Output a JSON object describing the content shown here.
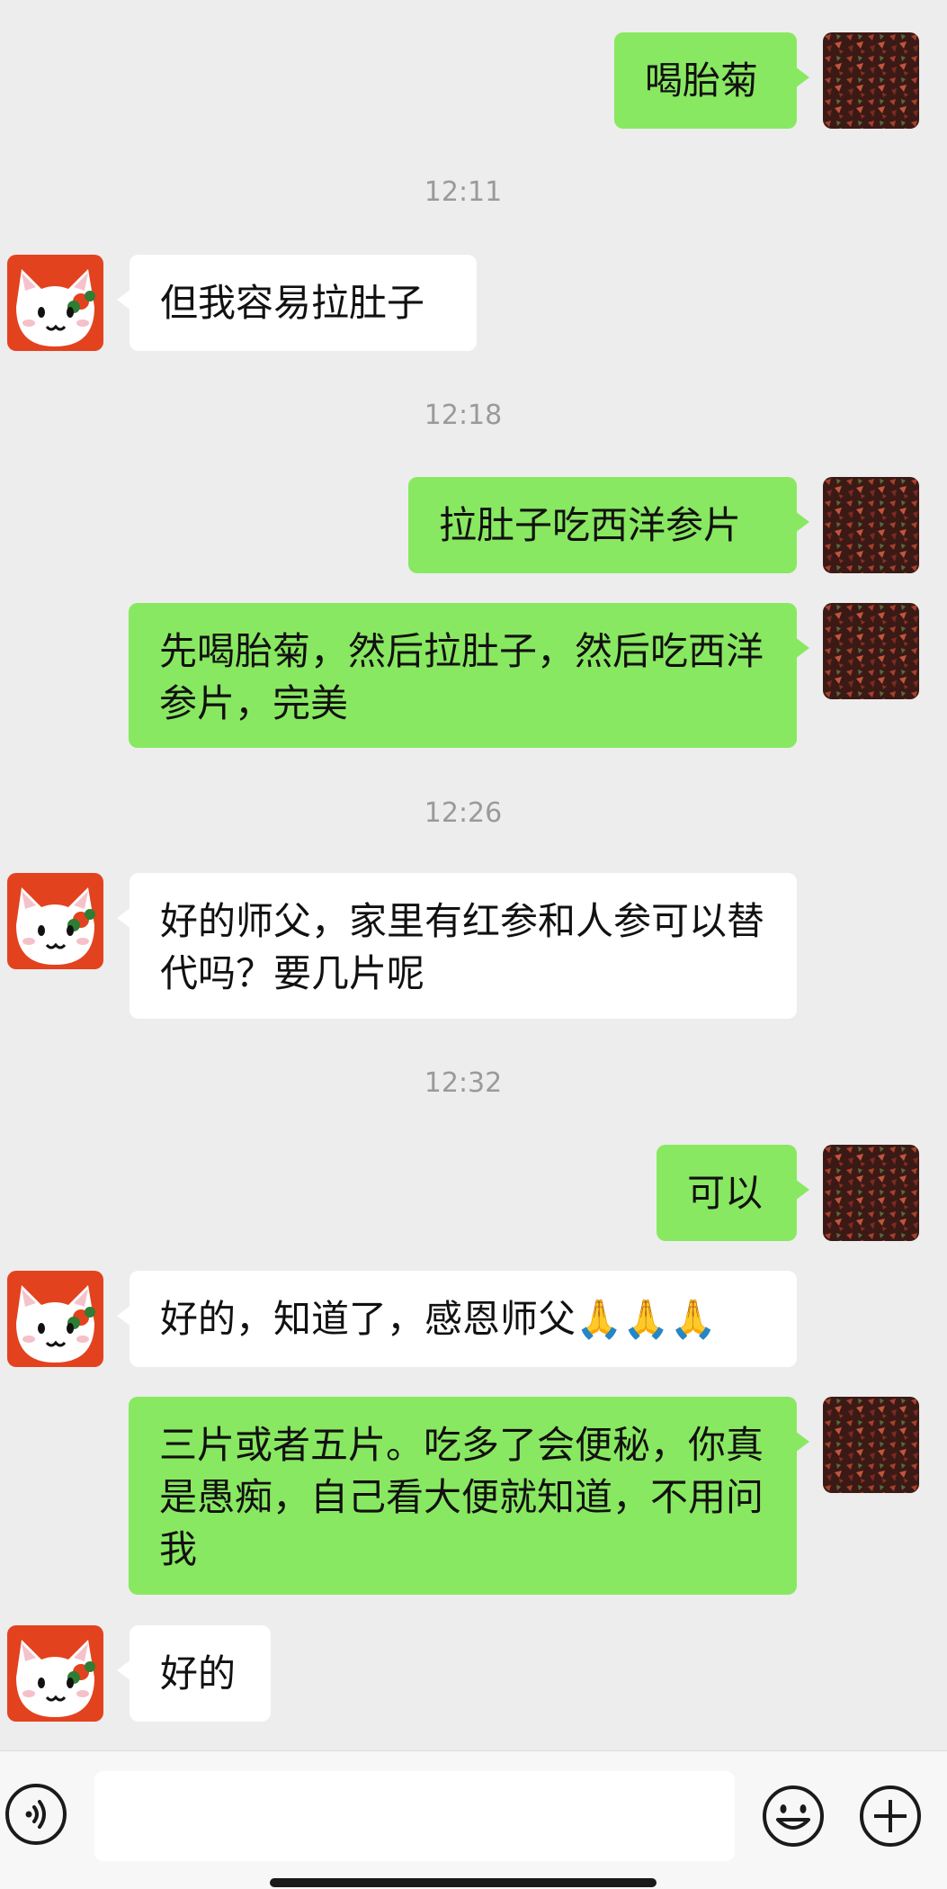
{
  "colors": {
    "background": "#ededed",
    "my_bubble": "#89e861",
    "their_bubble": "#ffffff",
    "timestamp": "#9a9a9a"
  },
  "messages": [
    {
      "side": "me",
      "text": "喝胎菊"
    },
    {
      "time": "12:11"
    },
    {
      "side": "them",
      "text": "但我容易拉肚子"
    },
    {
      "time": "12:18"
    },
    {
      "side": "me",
      "text": "拉肚子吃西洋参片"
    },
    {
      "side": "me",
      "text": "先喝胎菊，然后拉肚子，然后吃西洋参片，完美"
    },
    {
      "time": "12:26"
    },
    {
      "side": "them",
      "text": "好的师父，家里有红参和人参可以替代吗？要几片呢"
    },
    {
      "time": "12:32"
    },
    {
      "side": "me",
      "text": "可以"
    },
    {
      "side": "them",
      "text": "好的，知道了，感恩师父🙏🙏🙏"
    },
    {
      "side": "me",
      "text": "三片或者五片。吃多了会便秘，你真是愚痴，自己看大便就知道，不用问我"
    },
    {
      "side": "them",
      "text": "好的"
    }
  ],
  "input_bar": {
    "voice_icon": "voice-icon",
    "input_value": "",
    "emoji_icon": "emoji-icon",
    "plus_icon": "plus-icon"
  }
}
